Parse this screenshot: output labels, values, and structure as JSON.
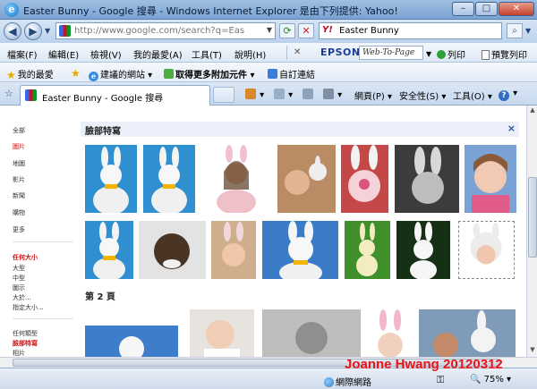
{
  "window": {
    "title": "Easter Bunny - Google 搜尋 - Windows Internet Explorer 是由下列提供: Yahoo!",
    "minimize": "–",
    "maximize": "□",
    "close": "✕"
  },
  "address": {
    "url": "http://www.google.com/search?q=Easter+Bu",
    "search_value": "Easter Bunny"
  },
  "menu": {
    "items": [
      "檔案(F)",
      "編輯(E)",
      "檢視(V)",
      "我的最愛(A)",
      "工具(T)",
      "說明(H)"
    ],
    "epson": "EPSON",
    "web_to_page": "Web-To-Page",
    "print": "列印",
    "print_preview": "預覽列印"
  },
  "favorites": {
    "label": "我的最愛",
    "suggested": "建議的網站",
    "addons": "取得更多附加元件",
    "feeds": "自訂連結"
  },
  "tab": {
    "title": "Easter Bunny - Google 搜尋"
  },
  "commands": {
    "page": "網頁(P)",
    "safety": "安全性(S)",
    "tools": "工具(O)"
  },
  "sidebar": {
    "types": [
      "全部",
      "圖片",
      "地圖",
      "影片",
      "新聞",
      "購物",
      "更多"
    ],
    "size_heading": "任何大小",
    "sizes": [
      "大型",
      "中型",
      "圖示",
      "大於...",
      "指定大小..."
    ],
    "type_heading": "任何類型",
    "face_label": "臉部特寫",
    "photo_label": "相片"
  },
  "results": {
    "section_title": "臉部特寫",
    "close_icon": "×",
    "page2_label": "第 2 頁"
  },
  "status": {
    "watermark": "Joanne Hwang 20120312",
    "zone": "網際網路",
    "zoom": "75%"
  }
}
